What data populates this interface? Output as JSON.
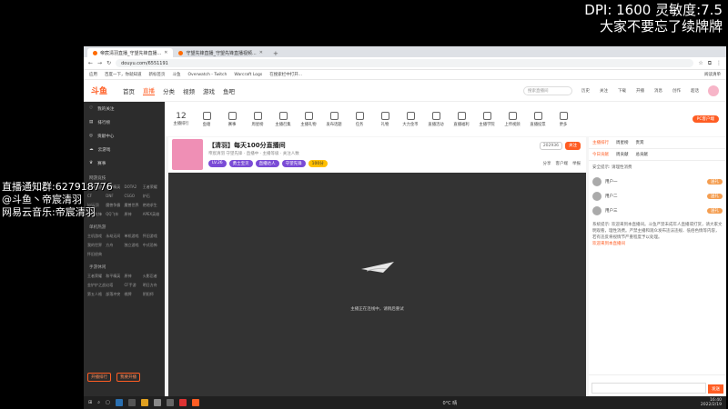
{
  "overlay": {
    "dpi_line": "DPI: 1600 灵敏度:7.5",
    "reminder": "大家不要忘了续牌牌",
    "notify_group": "直播通知群:627918776",
    "douyu": "@斗鱼丶帝宸清羽",
    "netease": "网易云音乐:帝宸清羽"
  },
  "browser": {
    "tab1": "帝宸清羽直播_守望先锋直播...",
    "tab2": "守望先锋直播_守望先锋直播视频...",
    "new_tab": "+",
    "url": "douyu.com/6551191",
    "bookmarks": [
      "应用",
      "百度一下，你就知道",
      "新标签页",
      "斗鱼",
      "Overwatch - Twitch",
      "Warcraft Logs",
      "在搜索栏中打开..."
    ],
    "bookmarks_right": "阅读清单"
  },
  "site": {
    "logo": "斗鱼",
    "nav": [
      "首页",
      "直播",
      "分类",
      "视频",
      "游戏",
      "鱼吧"
    ],
    "search_placeholder": "搜索直播间",
    "header_icons": [
      "历史",
      "关注",
      "下载",
      "开播",
      "消息",
      "创作",
      "超话"
    ]
  },
  "sidebar": {
    "items": [
      "我的关注",
      "排行榜",
      "贡献中心",
      "云游戏",
      "赛事"
    ],
    "section1": "网游竞技",
    "grid1": [
      "英雄联盟",
      "和平精英",
      "DOTA2",
      "王者荣耀",
      "CF",
      "DNF",
      "CSGO",
      "炉石",
      "lol云顶",
      "魔兽争霸",
      "魔兽世界",
      "绝地求生",
      "守望先锋",
      "QQ飞车",
      "原神",
      "APEX英雄"
    ],
    "section2": "单机热游",
    "grid2": [
      "主机游戏",
      "永劫无间",
      "单机游戏",
      "怀旧游戏",
      "我的世界",
      "方舟",
      "独立游戏",
      "中式恐怖",
      "怀旧经典"
    ],
    "section3": "手游休闲",
    "grid3": [
      "王者荣耀",
      "和平精英",
      "原神",
      "火影忍者",
      "金铲铲之战",
      "幻塔",
      "CF手游",
      "明日方舟",
      "第五人格",
      "部落冲突",
      "棋牌",
      "阴阳师"
    ],
    "btn_left": "开播排行",
    "btn_right": "我要开播"
  },
  "category_bar": {
    "rank_num": "12",
    "rank_label": "主播排行",
    "items": [
      "鱼塘",
      "赛事",
      "周星榜",
      "主播召集",
      "主播礼物",
      "发布话题",
      "任务",
      "礼物",
      "大力金币",
      "直播活动",
      "直播福利",
      "主播学院",
      "上传视频",
      "直播投票",
      "更多"
    ],
    "pc_button": "PC客户端",
    "pc_sub": "主播推荐"
  },
  "room": {
    "title": "【清羽】每天100分直播间",
    "meta": "帝宸清羽  守望先锋 · 直播中  · 主播等级 · 关注人数",
    "badge": "LV.26",
    "tags": [
      "勇士宝贝",
      "直播达人",
      "守望先锋"
    ],
    "tag_yellow": "100分",
    "follow": "关注",
    "fans": "202936",
    "actions": [
      "分享",
      "客户端",
      "举报"
    ]
  },
  "player": {
    "loading_text": "主播正在连线中，请稍后重试"
  },
  "right_panel": {
    "tabs": [
      "主播排行",
      "周星榜",
      "贵宾"
    ],
    "sub_tabs": [
      "今日贡献",
      "周贡献",
      "总贡献"
    ],
    "notice": "安全提示: 请理性消费",
    "ranks": [
      {
        "name": "用户一",
        "btn": "送礼"
      },
      {
        "name": "用户二",
        "btn": "送礼"
      },
      {
        "name": "用户三",
        "btn": "送礼"
      }
    ],
    "chat_system": "系统提示: 欢迎来到本直播间。斗鱼严禁未成年人直播或打赏，请大家文明观看，理性消费。严禁主播和观众发布违法违规、低俗色情等内容，若有违反将视情节严重程度予以处理。",
    "chat_user": "欢迎来到本直播间",
    "send": "发送"
  },
  "taskbar": {
    "time": "16:40",
    "date": "2022/2/19",
    "weather": "0°C 晴"
  }
}
